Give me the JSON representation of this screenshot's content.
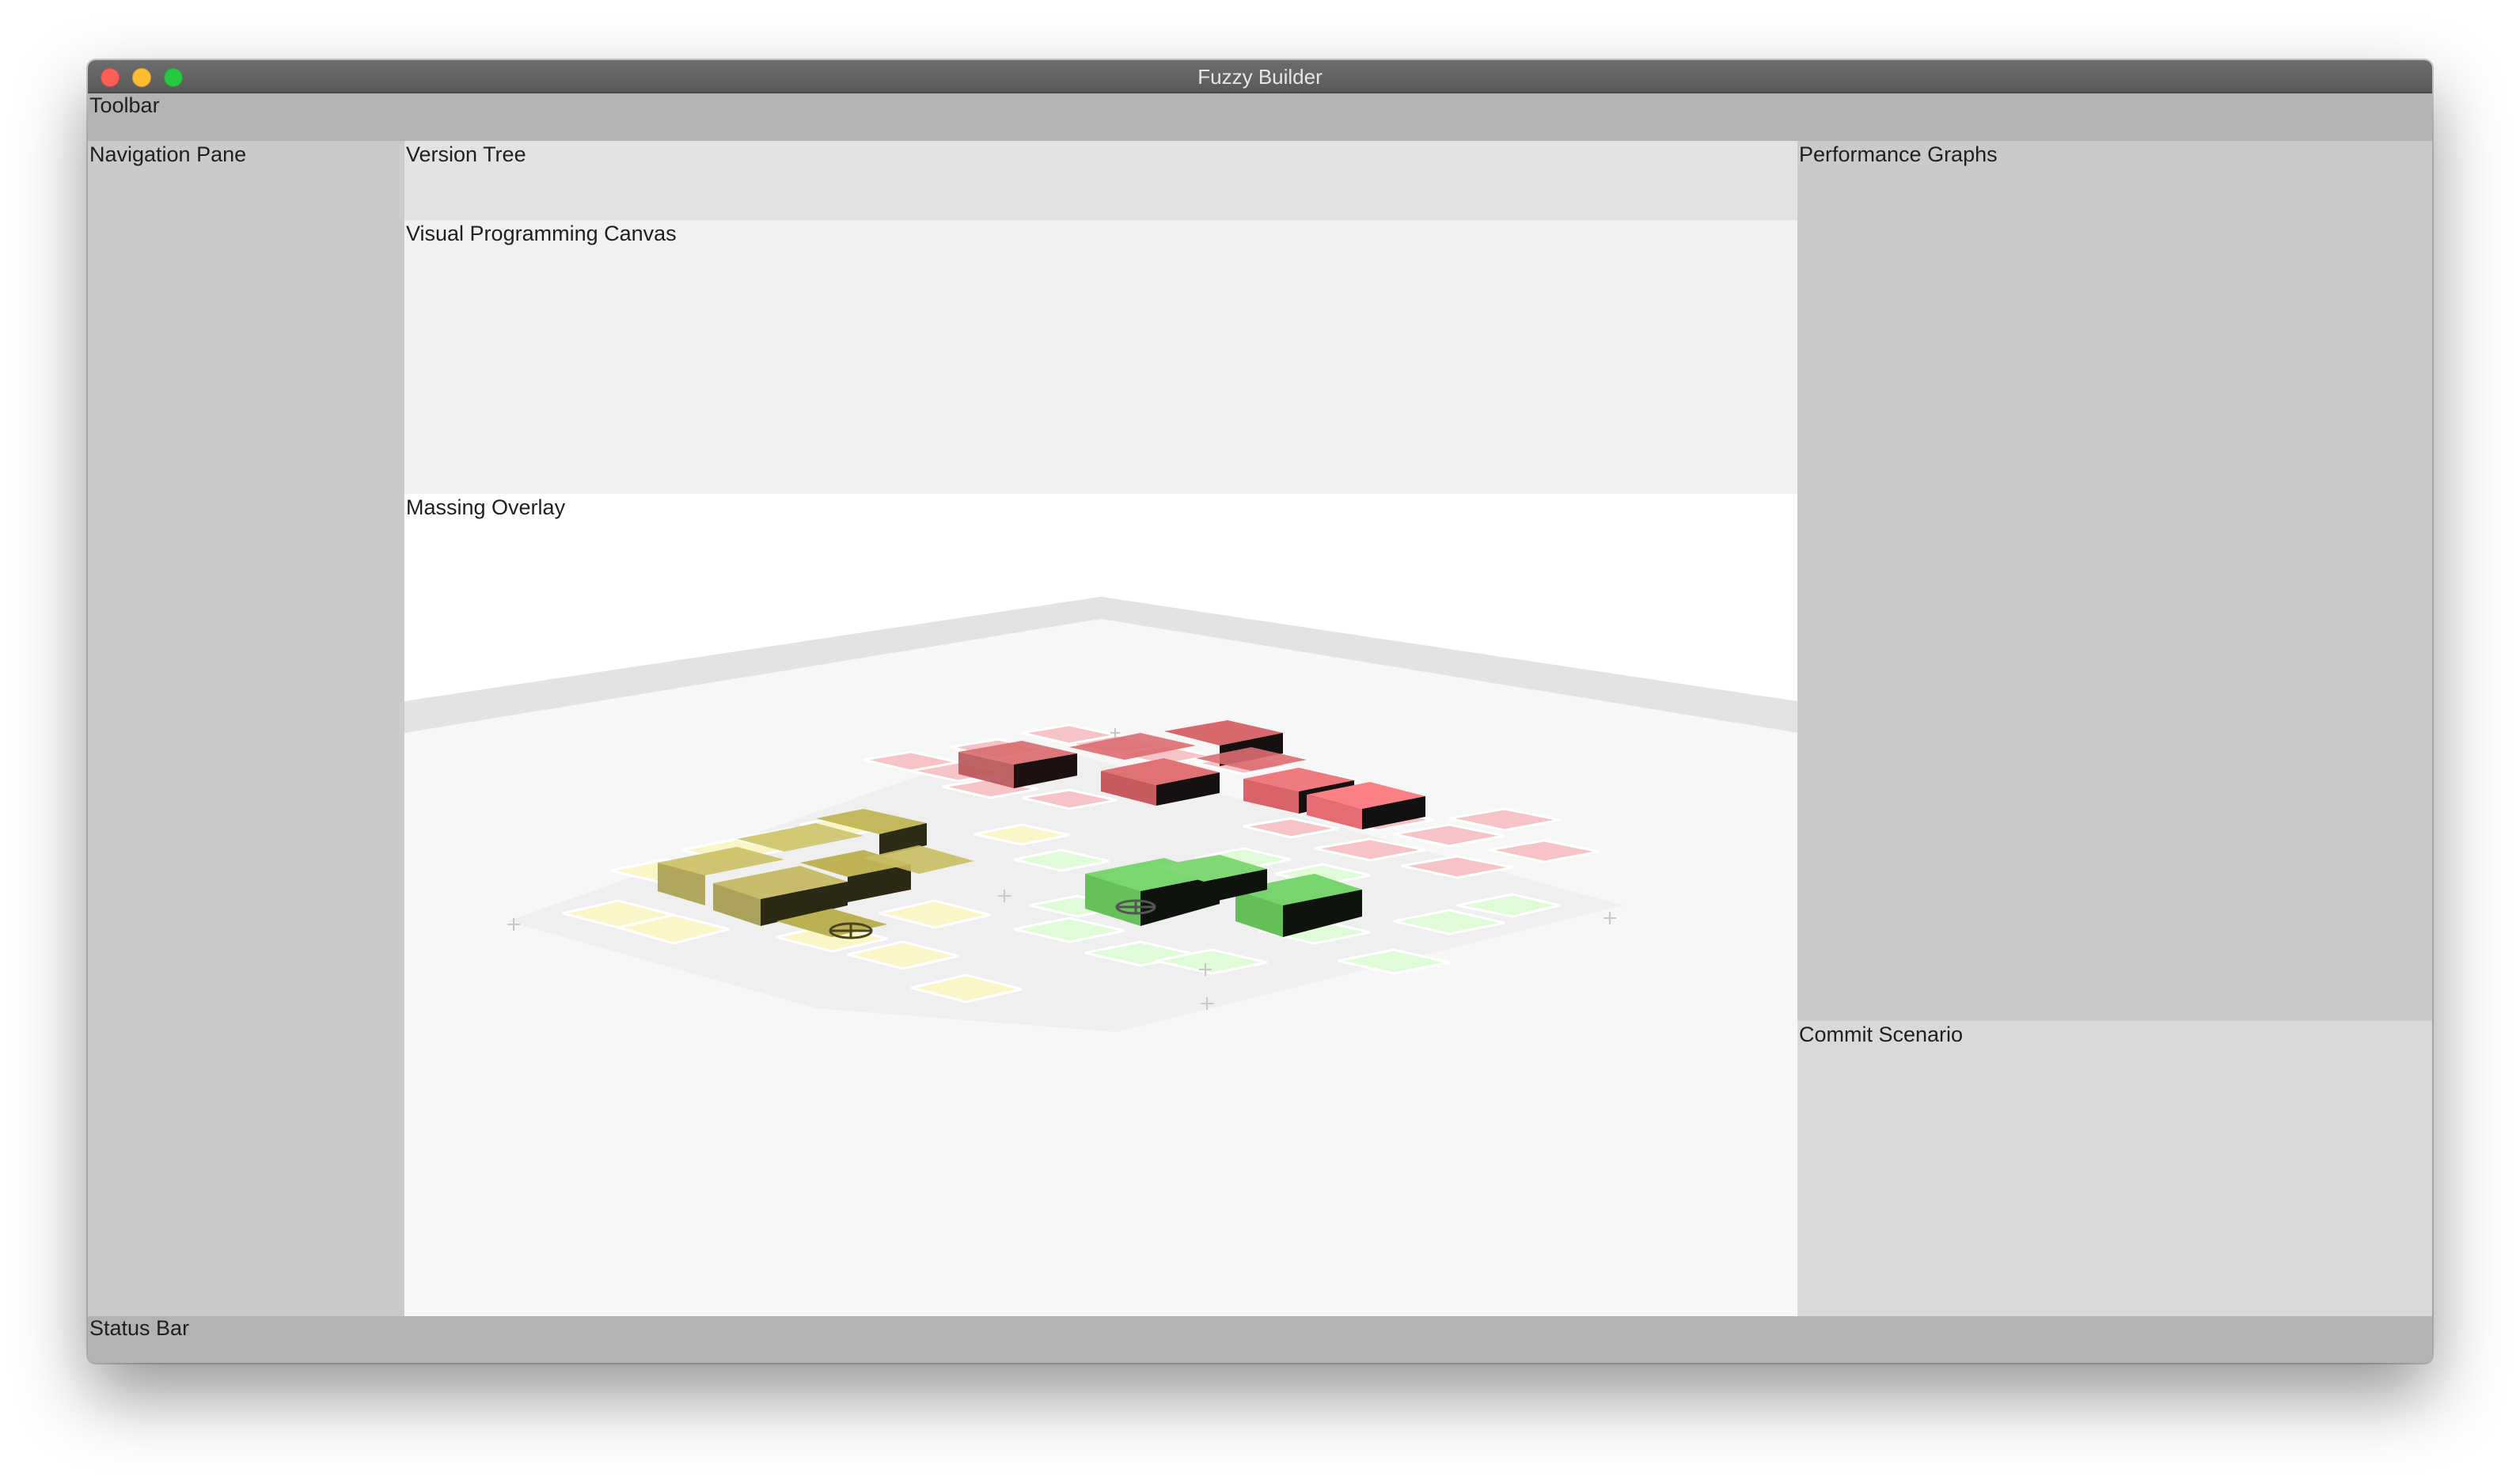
{
  "window": {
    "title": "Fuzzy Builder"
  },
  "panes": {
    "toolbar": "Toolbar",
    "navigation": "Navigation Pane",
    "version_tree": "Version Tree",
    "canvas": "Visual Programming Canvas",
    "massing": "Massing Overlay",
    "performance": "Performance Graphs",
    "commit": "Commit Scenario",
    "status": "Status Bar"
  },
  "colors": {
    "red_zone": "#f07b7b",
    "yellow_zone": "#c9c06a",
    "green_zone": "#7ad66e",
    "floor": "#f7f7f7",
    "wall": "#e3e3e3"
  },
  "massing_scene": {
    "zones": [
      {
        "name": "red-zone",
        "color": "#f07b7b",
        "building_count": 7
      },
      {
        "name": "yellow-zone",
        "color": "#c9c06a",
        "building_count": 5
      },
      {
        "name": "green-zone",
        "color": "#7ad66e",
        "building_count": 4
      }
    ]
  }
}
